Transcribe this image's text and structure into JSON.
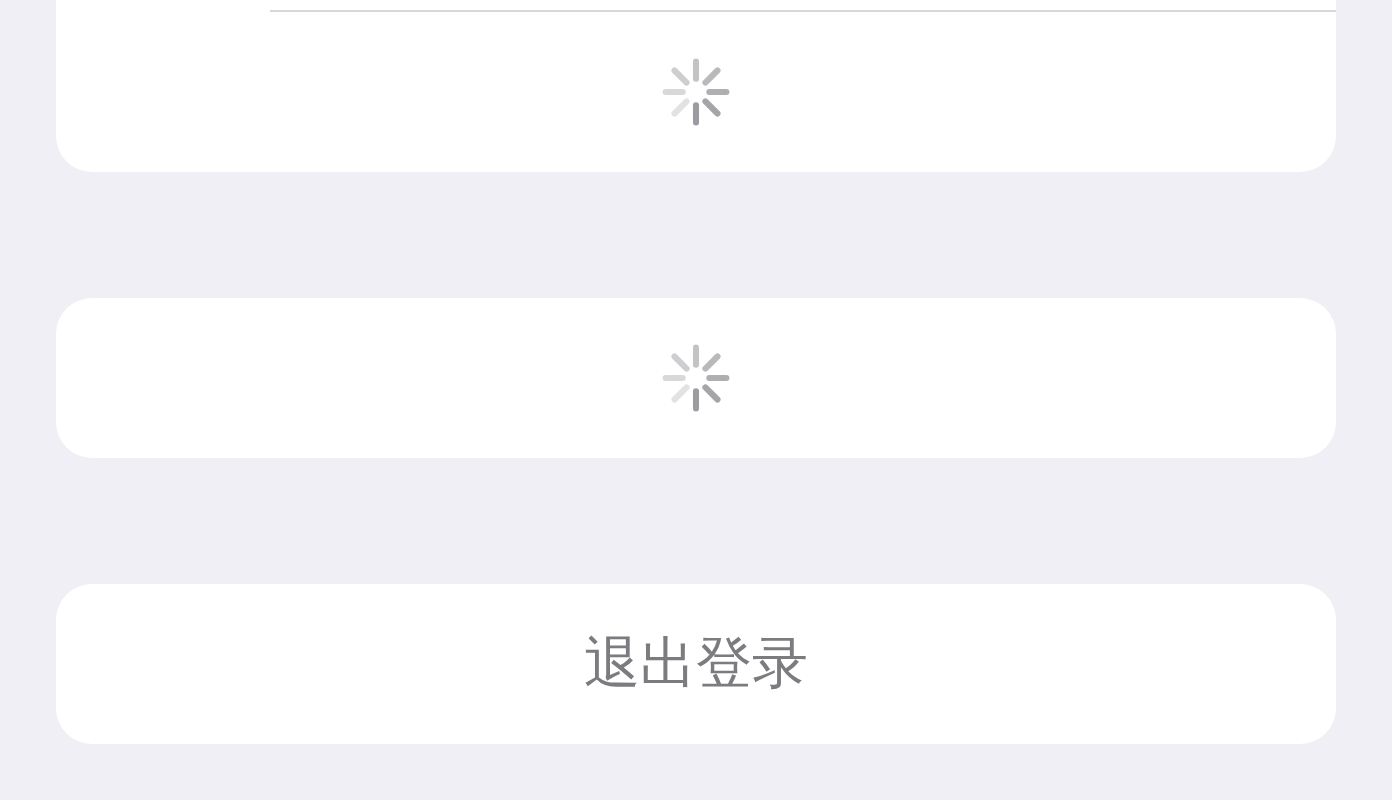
{
  "sections": [
    {
      "kind": "loading",
      "divider": true
    },
    {
      "kind": "loading",
      "divider": false
    }
  ],
  "logout_button": {
    "label": "退出登录"
  }
}
